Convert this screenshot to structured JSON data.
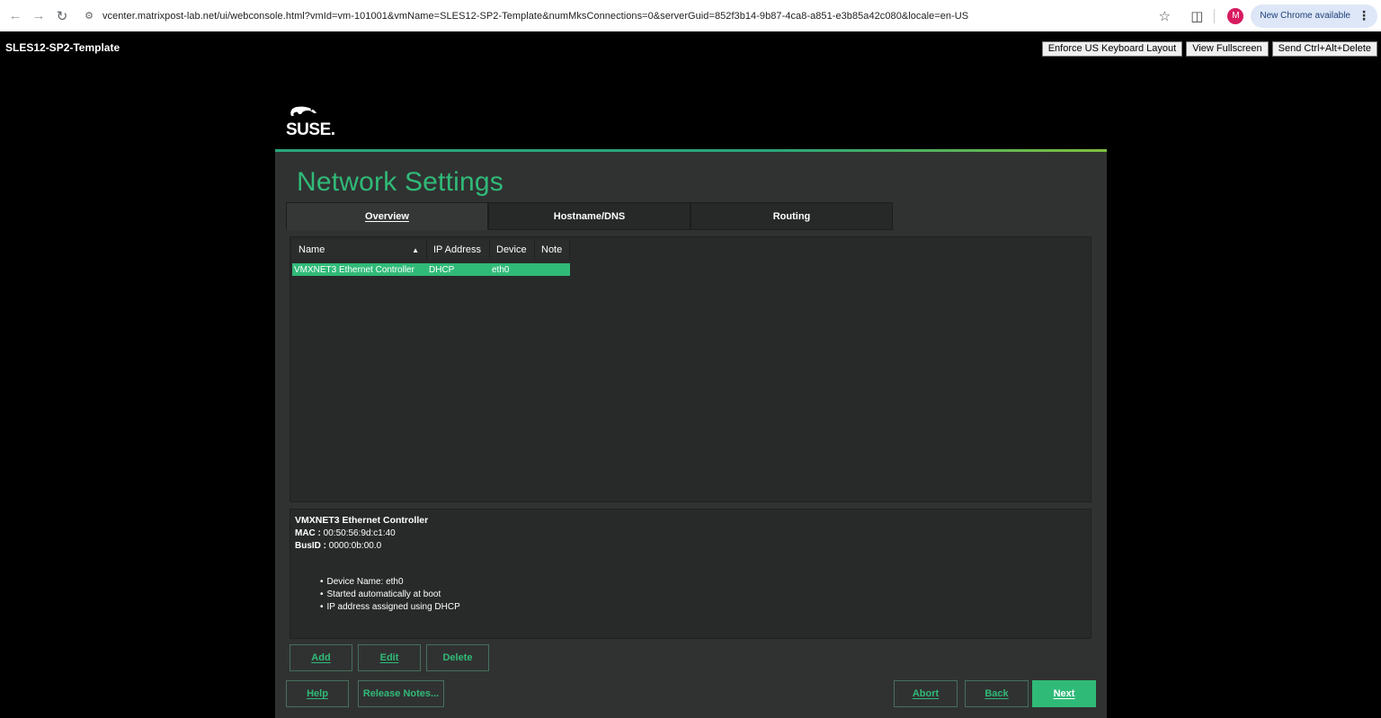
{
  "browser": {
    "url": "vcenter.matrixpost-lab.net/ui/webconsole.html?vmId=vm-101001&vmName=SLES12-SP2-Template&numMksConnections=0&serverGuid=852f3b14-9b87-4ca8-a851-e3b85a42c080&locale=en-US",
    "avatar_letter": "M",
    "update_label": "New Chrome available"
  },
  "console": {
    "vm_name": "SLES12-SP2-Template",
    "buttons": {
      "keyboard": "Enforce US Keyboard Layout",
      "fullscreen": "View Fullscreen",
      "ctrl_alt_del": "Send Ctrl+Alt+Delete"
    }
  },
  "installer": {
    "logo_text": "SUSE.",
    "title": "Network Settings",
    "tabs": [
      "Overview",
      "Hostname/DNS",
      "Routing"
    ],
    "table": {
      "headers": [
        "Name",
        "IP Address",
        "Device",
        "Note"
      ],
      "rows": [
        [
          "VMXNET3 Ethernet Controller",
          "DHCP",
          "eth0",
          ""
        ]
      ]
    },
    "details": {
      "title": "VMXNET3 Ethernet Controller",
      "mac_label": "MAC :",
      "mac_value": "00:50:56:9d:c1:40",
      "busid_label": "BusID :",
      "busid_value": "0000:0b:00.0",
      "bullets": [
        "Device Name: eth0",
        "Started automatically at boot",
        "IP address assigned using DHCP"
      ]
    },
    "buttons": {
      "add": "Add",
      "edit": "Edit",
      "delete": "Delete",
      "help": "Help",
      "release_notes": "Release Notes...",
      "abort": "Abort",
      "back": "Back",
      "next": "Next"
    }
  },
  "colors": {
    "suse_green": "#30ba78",
    "panel_bg": "#303232"
  }
}
